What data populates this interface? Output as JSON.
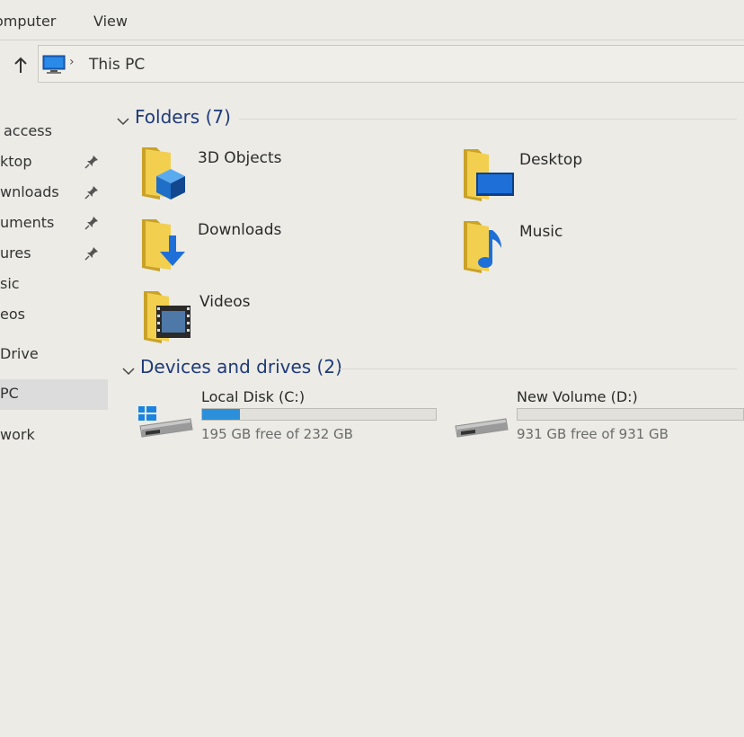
{
  "menu": {
    "items": [
      "omputer",
      "View"
    ]
  },
  "address": {
    "separator": "›",
    "location": "This PC"
  },
  "sidebar": {
    "items": [
      {
        "label": "access",
        "pinned": false
      },
      {
        "label": "ktop",
        "pinned": true
      },
      {
        "label": "wnloads",
        "pinned": true
      },
      {
        "label": "uments",
        "pinned": true
      },
      {
        "label": "ures",
        "pinned": true
      },
      {
        "label": "sic",
        "pinned": false
      },
      {
        "label": "eos",
        "pinned": false
      },
      {
        "label": "Drive",
        "pinned": false
      },
      {
        "label": "PC",
        "pinned": false,
        "selected": true
      },
      {
        "label": "work",
        "pinned": false
      }
    ]
  },
  "folders": {
    "title": "Folders (7)",
    "items": [
      {
        "label": "3D Objects",
        "icon": "3d-objects-folder-icon"
      },
      {
        "label": "Desktop",
        "icon": "desktop-folder-icon"
      },
      {
        "label": "Downloads",
        "icon": "downloads-folder-icon"
      },
      {
        "label": "Music",
        "icon": "music-folder-icon"
      },
      {
        "label": "Videos",
        "icon": "videos-folder-icon"
      }
    ]
  },
  "devices": {
    "title": "Devices and drives (2)",
    "items": [
      {
        "name": "Local Disk (C:)",
        "free_text": "195 GB free of 232 GB",
        "used_fraction": 0.16,
        "icon": "system-drive-icon"
      },
      {
        "name": "New Volume (D:)",
        "free_text": "931 GB free of 931 GB",
        "used_fraction": 0.0,
        "icon": "drive-icon"
      }
    ]
  },
  "colors": {
    "accent": "#2b8fd9",
    "folder": "#e8c547",
    "header_text": "#1e3a7a",
    "background": "#ecebe6"
  }
}
